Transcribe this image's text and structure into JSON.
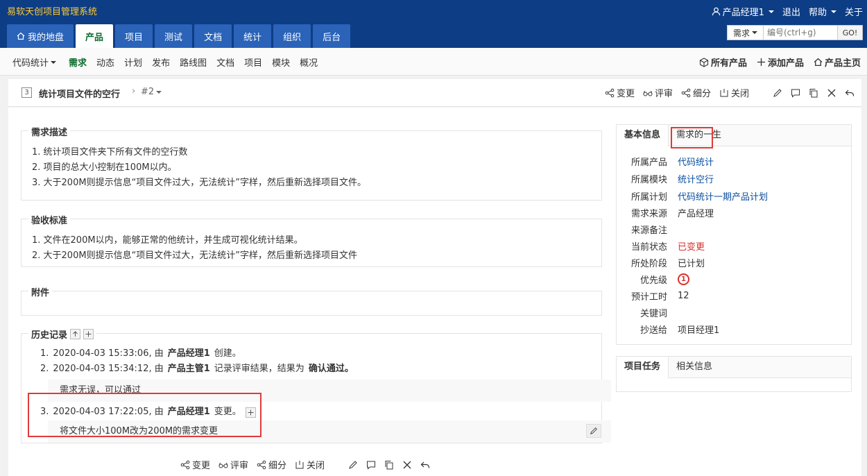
{
  "header": {
    "app_title": "易软天创项目管理系统",
    "user": "产品经理1",
    "logout": "退出",
    "help": "帮助",
    "about": "关于"
  },
  "main_nav": [
    "我的地盘",
    "产品",
    "项目",
    "测试",
    "文档",
    "统计",
    "组织",
    "后台"
  ],
  "search": {
    "type": "需求",
    "placeholder": "编号(ctrl+g)",
    "go": "GO!"
  },
  "sub_nav": {
    "product": "代码统计",
    "items": [
      "需求",
      "动态",
      "计划",
      "发布",
      "路线图",
      "文档",
      "项目",
      "模块",
      "概况"
    ],
    "right": [
      "所有产品",
      "添加产品",
      "产品主页"
    ]
  },
  "title_bar": {
    "id": "3",
    "title": "统计项目文件的空行",
    "version": "#2",
    "actions": [
      "变更",
      "评审",
      "细分",
      "关闭"
    ]
  },
  "description": {
    "title": "需求描述",
    "lines": [
      "1. 统计项目文件夹下所有文件的空行数",
      "2. 项目的总大小控制在100M以内。",
      "3. 大于200M则提示信息“项目文件过大，无法统计”字样，然后重新选择项目文件。"
    ]
  },
  "acceptance": {
    "title": "验收标准",
    "lines": [
      "1. 文件在200M以内，能够正常的他统计，并生成可视化统计结果。",
      "2. 大于200M则提示信息“项目文件过大，无法统计”字样，然后重新选择项目文件"
    ]
  },
  "attachment": {
    "title": "附件"
  },
  "history": {
    "title": "历史记录",
    "items": [
      {
        "num": "1.",
        "pre": "2020-04-03 15:33:06, 由",
        "actor": "产品经理1",
        "post": "创建。",
        "extra": ""
      },
      {
        "num": "2.",
        "pre": "2020-04-03 15:34:12, 由",
        "actor": "产品主管1",
        "post": "记录评审结果，结果为",
        "extra": "确认通过。"
      },
      {
        "num": "3.",
        "pre": "2020-04-03 17:22:05, 由",
        "actor": "产品经理1",
        "post": "变更。",
        "extra": ""
      }
    ],
    "comment_2": "需求无误，可以通过",
    "comment_3": "将文件大小100M改为200M的需求变更"
  },
  "basic_info": {
    "tabs": [
      "基本信息",
      "需求的一生"
    ],
    "rows": [
      {
        "label": "所属产品",
        "value": "代码统计"
      },
      {
        "label": "所属模块",
        "value": "统计空行"
      },
      {
        "label": "所属计划",
        "value": "代码统计一期产品计划"
      },
      {
        "label": "需求来源",
        "value": "产品经理"
      },
      {
        "label": "来源备注",
        "value": ""
      },
      {
        "label": "当前状态",
        "value": "已变更"
      },
      {
        "label": "所处阶段",
        "value": "已计划"
      },
      {
        "label": "优先级",
        "value": "1"
      },
      {
        "label": "预计工时",
        "value": "12"
      },
      {
        "label": "关键词",
        "value": ""
      },
      {
        "label": "抄送给",
        "value": "项目经理1"
      }
    ]
  },
  "task_panel": {
    "tabs": [
      "项目任务",
      "相关信息"
    ]
  },
  "colors": {
    "header_bg": "#0d3d85",
    "tab_bg": "#2a63b8",
    "active_green": "#0d6c2f",
    "link": "#0a4ea0",
    "status_red": "#d9302c"
  }
}
